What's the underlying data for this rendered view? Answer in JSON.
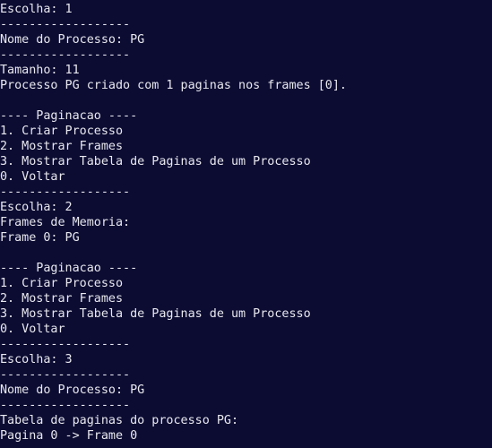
{
  "terminal": {
    "lines": [
      "Escolha: 1",
      "------------------",
      "Nome do Processo: PG",
      "------------------",
      "Tamanho: 11",
      "Processo PG criado com 1 paginas nos frames [0].",
      "",
      "---- Paginacao ----",
      "1. Criar Processo",
      "2. Mostrar Frames",
      "3. Mostrar Tabela de Paginas de um Processo",
      "0. Voltar",
      "------------------",
      "Escolha: 2",
      "Frames de Memoria:",
      "Frame 0: PG",
      "",
      "---- Paginacao ----",
      "1. Criar Processo",
      "2. Mostrar Frames",
      "3. Mostrar Tabela de Paginas de um Processo",
      "0. Voltar",
      "------------------",
      "Escolha: 3",
      "------------------",
      "Nome do Processo: PG",
      "------------------",
      "Tabela de paginas do processo PG:",
      "Pagina 0 -> Frame 0"
    ]
  },
  "colors": {
    "background": "#0c0c33",
    "text": "#e8e8ef"
  }
}
